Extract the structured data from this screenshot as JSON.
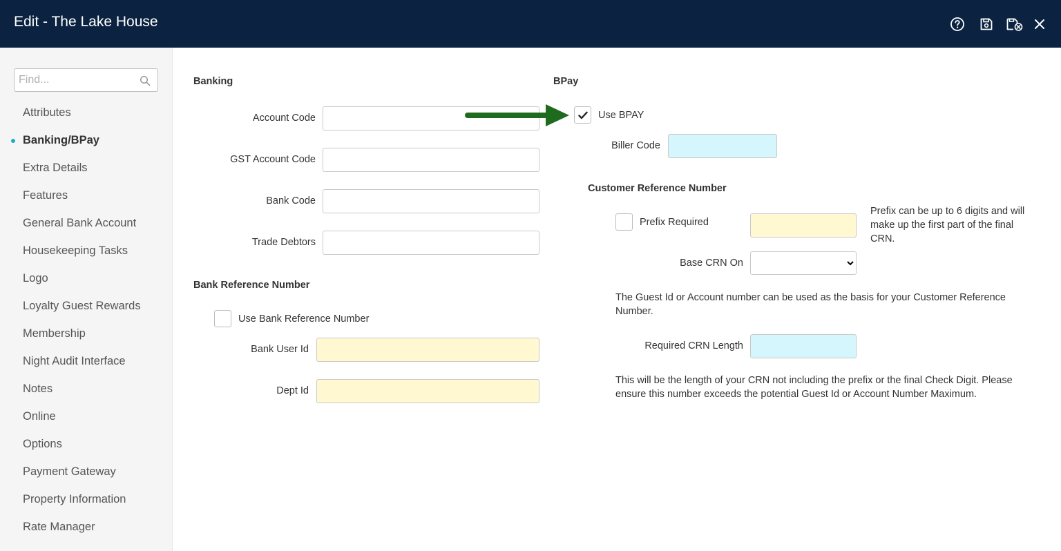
{
  "window": {
    "title": "Edit - The Lake House"
  },
  "toolbar": {
    "icons": [
      "help-icon",
      "save-icon",
      "save-close-icon",
      "close-icon"
    ]
  },
  "sidebar": {
    "search_placeholder": "Find...",
    "items": [
      {
        "label": "Attributes",
        "active": false
      },
      {
        "label": "Banking/BPay",
        "active": true
      },
      {
        "label": "Extra Details",
        "active": false
      },
      {
        "label": "Features",
        "active": false
      },
      {
        "label": "General Bank Account",
        "active": false
      },
      {
        "label": "Housekeeping Tasks",
        "active": false
      },
      {
        "label": "Logo",
        "active": false
      },
      {
        "label": "Loyalty Guest Rewards",
        "active": false
      },
      {
        "label": "Membership",
        "active": false
      },
      {
        "label": "Night Audit Interface",
        "active": false
      },
      {
        "label": "Notes",
        "active": false
      },
      {
        "label": "Online",
        "active": false
      },
      {
        "label": "Options",
        "active": false
      },
      {
        "label": "Payment Gateway",
        "active": false
      },
      {
        "label": "Property Information",
        "active": false
      },
      {
        "label": "Rate Manager",
        "active": false
      }
    ]
  },
  "banking": {
    "title": "Banking",
    "account_code_label": "Account Code",
    "account_code_value": "",
    "gst_account_code_label": "GST Account Code",
    "gst_account_code_value": "",
    "bank_code_label": "Bank Code",
    "bank_code_value": "",
    "trade_debtors_label": "Trade Debtors",
    "trade_debtors_value": ""
  },
  "bank_reference": {
    "title": "Bank Reference Number",
    "use_label": "Use Bank Reference Number",
    "use_checked": false,
    "bank_user_id_label": "Bank User Id",
    "bank_user_id_value": "",
    "dept_id_label": "Dept Id",
    "dept_id_value": ""
  },
  "bpay": {
    "title": "BPay",
    "use_bpay_label": "Use BPAY",
    "use_bpay_checked": true,
    "biller_code_label": "Biller Code",
    "biller_code_value": ""
  },
  "crn": {
    "title": "Customer Reference Number",
    "prefix_required_label": "Prefix Required",
    "prefix_required_checked": false,
    "prefix_value": "",
    "prefix_help": "Prefix can be up to 6 digits and will make up the first part of the final CRN.",
    "base_crn_on_label": "Base CRN On",
    "base_crn_on_value": "",
    "basis_help": "The Guest Id or Account number can be used as the basis for your Customer Reference Number.",
    "required_length_label": "Required CRN Length",
    "required_length_value": "",
    "length_help": "This will be the length of your CRN not including the prefix or the final Check Digit. Please ensure this number exceeds the potential Guest Id or Account Number Maximum."
  },
  "colors": {
    "header_bg": "#0b2341",
    "active_dot": "#1fa9d1",
    "arrow": "#1e6b1e",
    "input_yellow": "#fff8d1",
    "input_cyan": "#d5f6fc"
  }
}
